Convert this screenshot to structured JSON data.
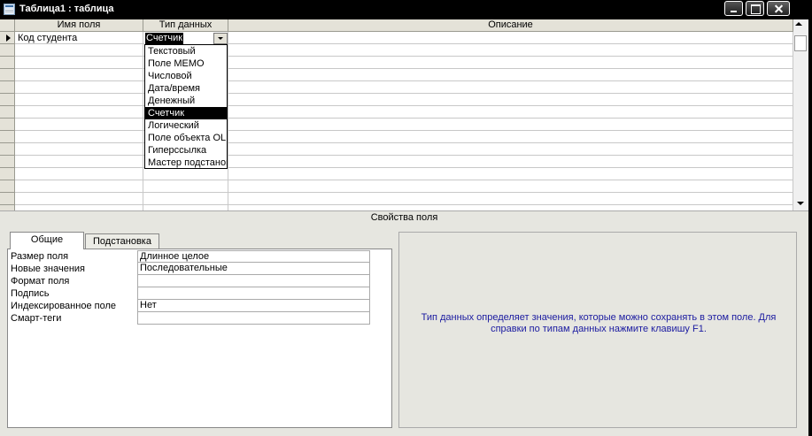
{
  "window": {
    "title": "Таблица1 : таблица"
  },
  "grid": {
    "columns": [
      "Имя поля",
      "Тип данных",
      "Описание"
    ],
    "first_row": {
      "field_name": "Код студента",
      "data_type": "Счетчик",
      "description": ""
    }
  },
  "dropdown": {
    "options": [
      "Текстовый",
      "Поле MEMO",
      "Числовой",
      "Дата/время",
      "Денежный",
      "Счетчик",
      "Логический",
      "Поле объекта OLE",
      "Гиперссылка",
      "Мастер подстановок..."
    ],
    "selected_index": 5
  },
  "properties_bar": {
    "label": "Свойства поля"
  },
  "tabs": [
    {
      "label": "Общие",
      "active": true
    },
    {
      "label": "Подстановка",
      "active": false
    }
  ],
  "properties": [
    {
      "name": "Размер поля",
      "value": "Длинное целое"
    },
    {
      "name": "Новые значения",
      "value": "Последовательные"
    },
    {
      "name": "Формат поля",
      "value": ""
    },
    {
      "name": "Подпись",
      "value": ""
    },
    {
      "name": "Индексированное поле",
      "value": "Нет"
    },
    {
      "name": "Смарт-теги",
      "value": ""
    }
  ],
  "help": {
    "text": "Тип данных определяет значения, которые можно сохранять в этом поле.  Для справки по типам данных нажмите клавишу F1."
  },
  "colors": {
    "help_text": "#1a1aa0",
    "header_bg": "#e4e2d8",
    "pane_bg": "#e6e6e0"
  }
}
